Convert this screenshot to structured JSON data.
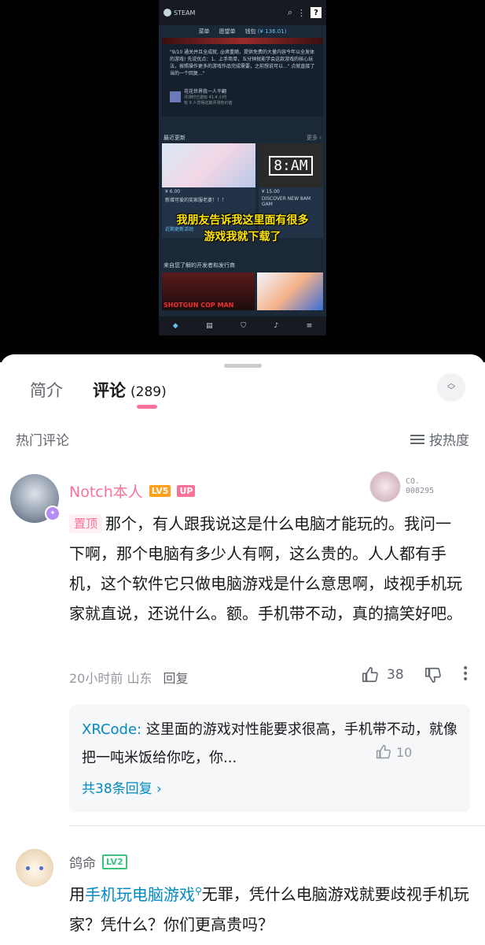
{
  "video": {
    "steam_logo": "STEAM",
    "nav": [
      "菜单",
      "愿望单",
      "钱包"
    ],
    "wallet_amount": "(¥ 136.01)",
    "feature_text": "\"9/10 通关并且全成就, @肃重随，提供免费的大量内容今年以全发体的游戏! 先说优点：1、上手简单，五分钟就能学会这款游戏的核心玩法，按照操作更多的游戏作品完成需要，之前想说可以...\" 点就直接了当的一个回复...\"",
    "feature_user": "花花世界我一人干翻",
    "feature_user_sub": "评测时已游玩 41.4 小时",
    "feature_user_sub2": "有 9 人觉得这篇评测有价值",
    "recent_title": "最近更新",
    "recent_more": "更多 ›",
    "card1_price": "¥ 6.00",
    "card1_desc": "新增可爱的奖家服老婆！！！",
    "card1_tag": "近期更新活动",
    "card2_clock": "8:AM",
    "card2_price": "¥ 15.00",
    "card2_desc": "DISCOVER NEW 8AM GAM",
    "subtitle_line1": "我朋友告诉我这里面有很多",
    "subtitle_line2": "游戏我就下载了",
    "dev_title": "来自您了解的开发者和发行商",
    "game1_title": "SHOTGUN COP MAN",
    "bottom_icons": [
      "tag-icon",
      "news-icon",
      "shield-icon",
      "bell-icon",
      "menu-icon"
    ]
  },
  "tabs": {
    "intro": "简介",
    "comments": "评论",
    "comment_count": "(289)"
  },
  "hot_comments_label": "热门评论",
  "sort_label": "按热度",
  "comment1": {
    "user": "Notch本人",
    "level": "LV5",
    "up_badge": "UP",
    "fan_id_line1": "CO.",
    "fan_id_line2": "008295",
    "pinned": "置顶",
    "text": "那个，有人跟我说这是什么电脑才能玩的。我问一下啊，那个电脑有多少人有啊，这么贵的。人人都有手机，这个软件它只做电脑游戏是什么意思啊，歧视手机玩家就直说，还说什么。额。手机带不动，真的搞笑好吧。",
    "time": "20小时前",
    "location": "山东",
    "reply_label": "回复",
    "likes": "38"
  },
  "reply": {
    "user": "XRCode",
    "text": "这里面的游戏对性能要求很高，手机带不动，就像把一吨米饭给你吃，你...",
    "likes": "10",
    "more": "共38条回复 ›"
  },
  "comment2": {
    "user": "鸽命",
    "level": "LV2",
    "text_prefix": "用",
    "link": "手机玩电脑游戏",
    "text_suffix": "无罪，凭什么电脑游戏就要歧视手机玩家？凭什么？你们更高贵吗？"
  },
  "colors": {
    "accent_pink": "#fb7299",
    "link_blue": "#008ac5",
    "level5": "#ff9f1a",
    "level2": "#3cc27d",
    "steam_bg": "#1b2838"
  }
}
